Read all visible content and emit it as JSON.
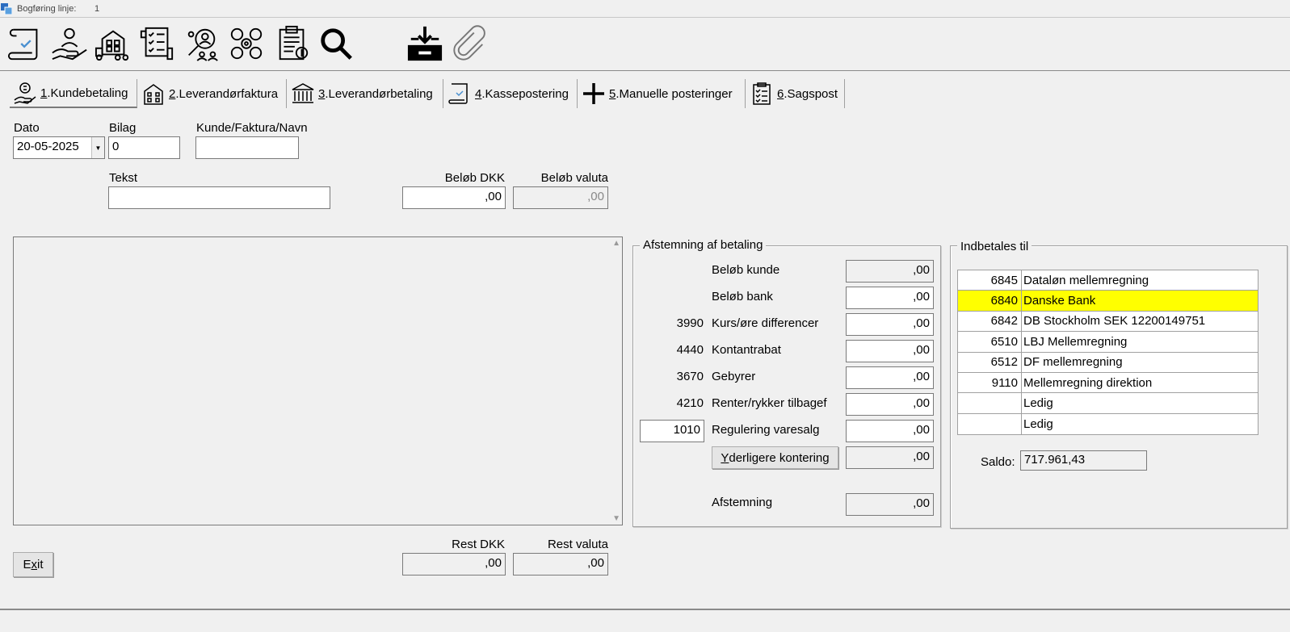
{
  "window": {
    "title": "Bogføring linje:",
    "line_number": "1"
  },
  "toolbar": {
    "icons": [
      "bookkeeping-scroll-icon",
      "customer-hand-icon",
      "supplier-truck-icon",
      "checklist-icon",
      "people-search-icon",
      "settings-tags-icon",
      "clipboard-icon",
      "search-icon",
      "inbox-download-icon",
      "paperclip-icon"
    ]
  },
  "tabs": [
    {
      "key": "1",
      "label": ".Kundebetaling",
      "icon": "money-hand-icon",
      "active": true
    },
    {
      "key": "2",
      "label": ".Leverandørfaktura",
      "icon": "building-icon",
      "active": false
    },
    {
      "key": "3",
      "label": ".Leverandørbetaling",
      "icon": "bank-icon",
      "active": false
    },
    {
      "key": "4",
      "label": ".Kassepostering",
      "icon": "scroll-check-icon",
      "active": false
    },
    {
      "key": "5",
      "label": ".Manuelle posteringer",
      "icon": "plus-icon",
      "active": false
    },
    {
      "key": "6",
      "label": ".Sagspost",
      "icon": "clipboard-list-icon",
      "active": false
    }
  ],
  "form": {
    "dato_label": "Dato",
    "dato_value": "20-05-2025",
    "bilag_label": "Bilag",
    "bilag_value": "0",
    "kunde_label": "Kunde/Faktura/Navn",
    "kunde_value": "",
    "tekst_label": "Tekst",
    "tekst_value": "",
    "belob_dkk_label": "Beløb DKK",
    "belob_dkk_value": ",00",
    "belob_valuta_label": "Beløb valuta",
    "belob_valuta_value": ",00",
    "rest_dkk_label": "Rest DKK",
    "rest_dkk_value": ",00",
    "rest_valuta_label": "Rest valuta",
    "rest_valuta_value": ",00"
  },
  "reconciliation": {
    "title": "Afstemning af betaling",
    "rows": [
      {
        "account": "",
        "label": "Beløb kunde",
        "value": ",00",
        "readonly": true
      },
      {
        "account": "",
        "label": "Beløb bank",
        "value": ",00",
        "readonly": false
      },
      {
        "account": "3990",
        "label": "Kurs/øre differencer",
        "value": ",00",
        "readonly": false
      },
      {
        "account": "4440",
        "label": "Kontantrabat",
        "value": ",00",
        "readonly": false
      },
      {
        "account": "3670",
        "label": "Gebyrer",
        "value": ",00",
        "readonly": false
      },
      {
        "account": "4210",
        "label": "Renter/rykker tilbagef",
        "value": ",00",
        "readonly": false
      },
      {
        "account": "1010",
        "label": "Regulering varesalg",
        "value": ",00",
        "readonly": false
      }
    ],
    "extra_button_hotkey": "Y",
    "extra_button_rest": "derligere kontering",
    "extra_value": ",00",
    "afstemning_label": "Afstemning",
    "afstemning_value": ",00"
  },
  "payto": {
    "title": "Indbetales til",
    "accounts": [
      {
        "number": "6845",
        "name": "Dataløn mellemregning",
        "selected": false
      },
      {
        "number": "6840",
        "name": "Danske Bank",
        "selected": true
      },
      {
        "number": "6842",
        "name": "DB Stockholm SEK 12200149751",
        "selected": false
      },
      {
        "number": "6510",
        "name": "LBJ Mellemregning",
        "selected": false
      },
      {
        "number": "6512",
        "name": "DF mellemregning",
        "selected": false
      },
      {
        "number": "9110",
        "name": "Mellemregning direktion",
        "selected": false
      },
      {
        "number": "",
        "name": "Ledig",
        "selected": false
      },
      {
        "number": "",
        "name": "Ledig",
        "selected": false
      }
    ],
    "saldo_label": "Saldo:",
    "saldo_value": "717.961,43"
  },
  "exit_button": {
    "hotkey_prefix": "E",
    "hotkey": "x",
    "rest": "it"
  },
  "colors": {
    "background": "#f0f0f0",
    "selected_row": "#ffff00"
  }
}
